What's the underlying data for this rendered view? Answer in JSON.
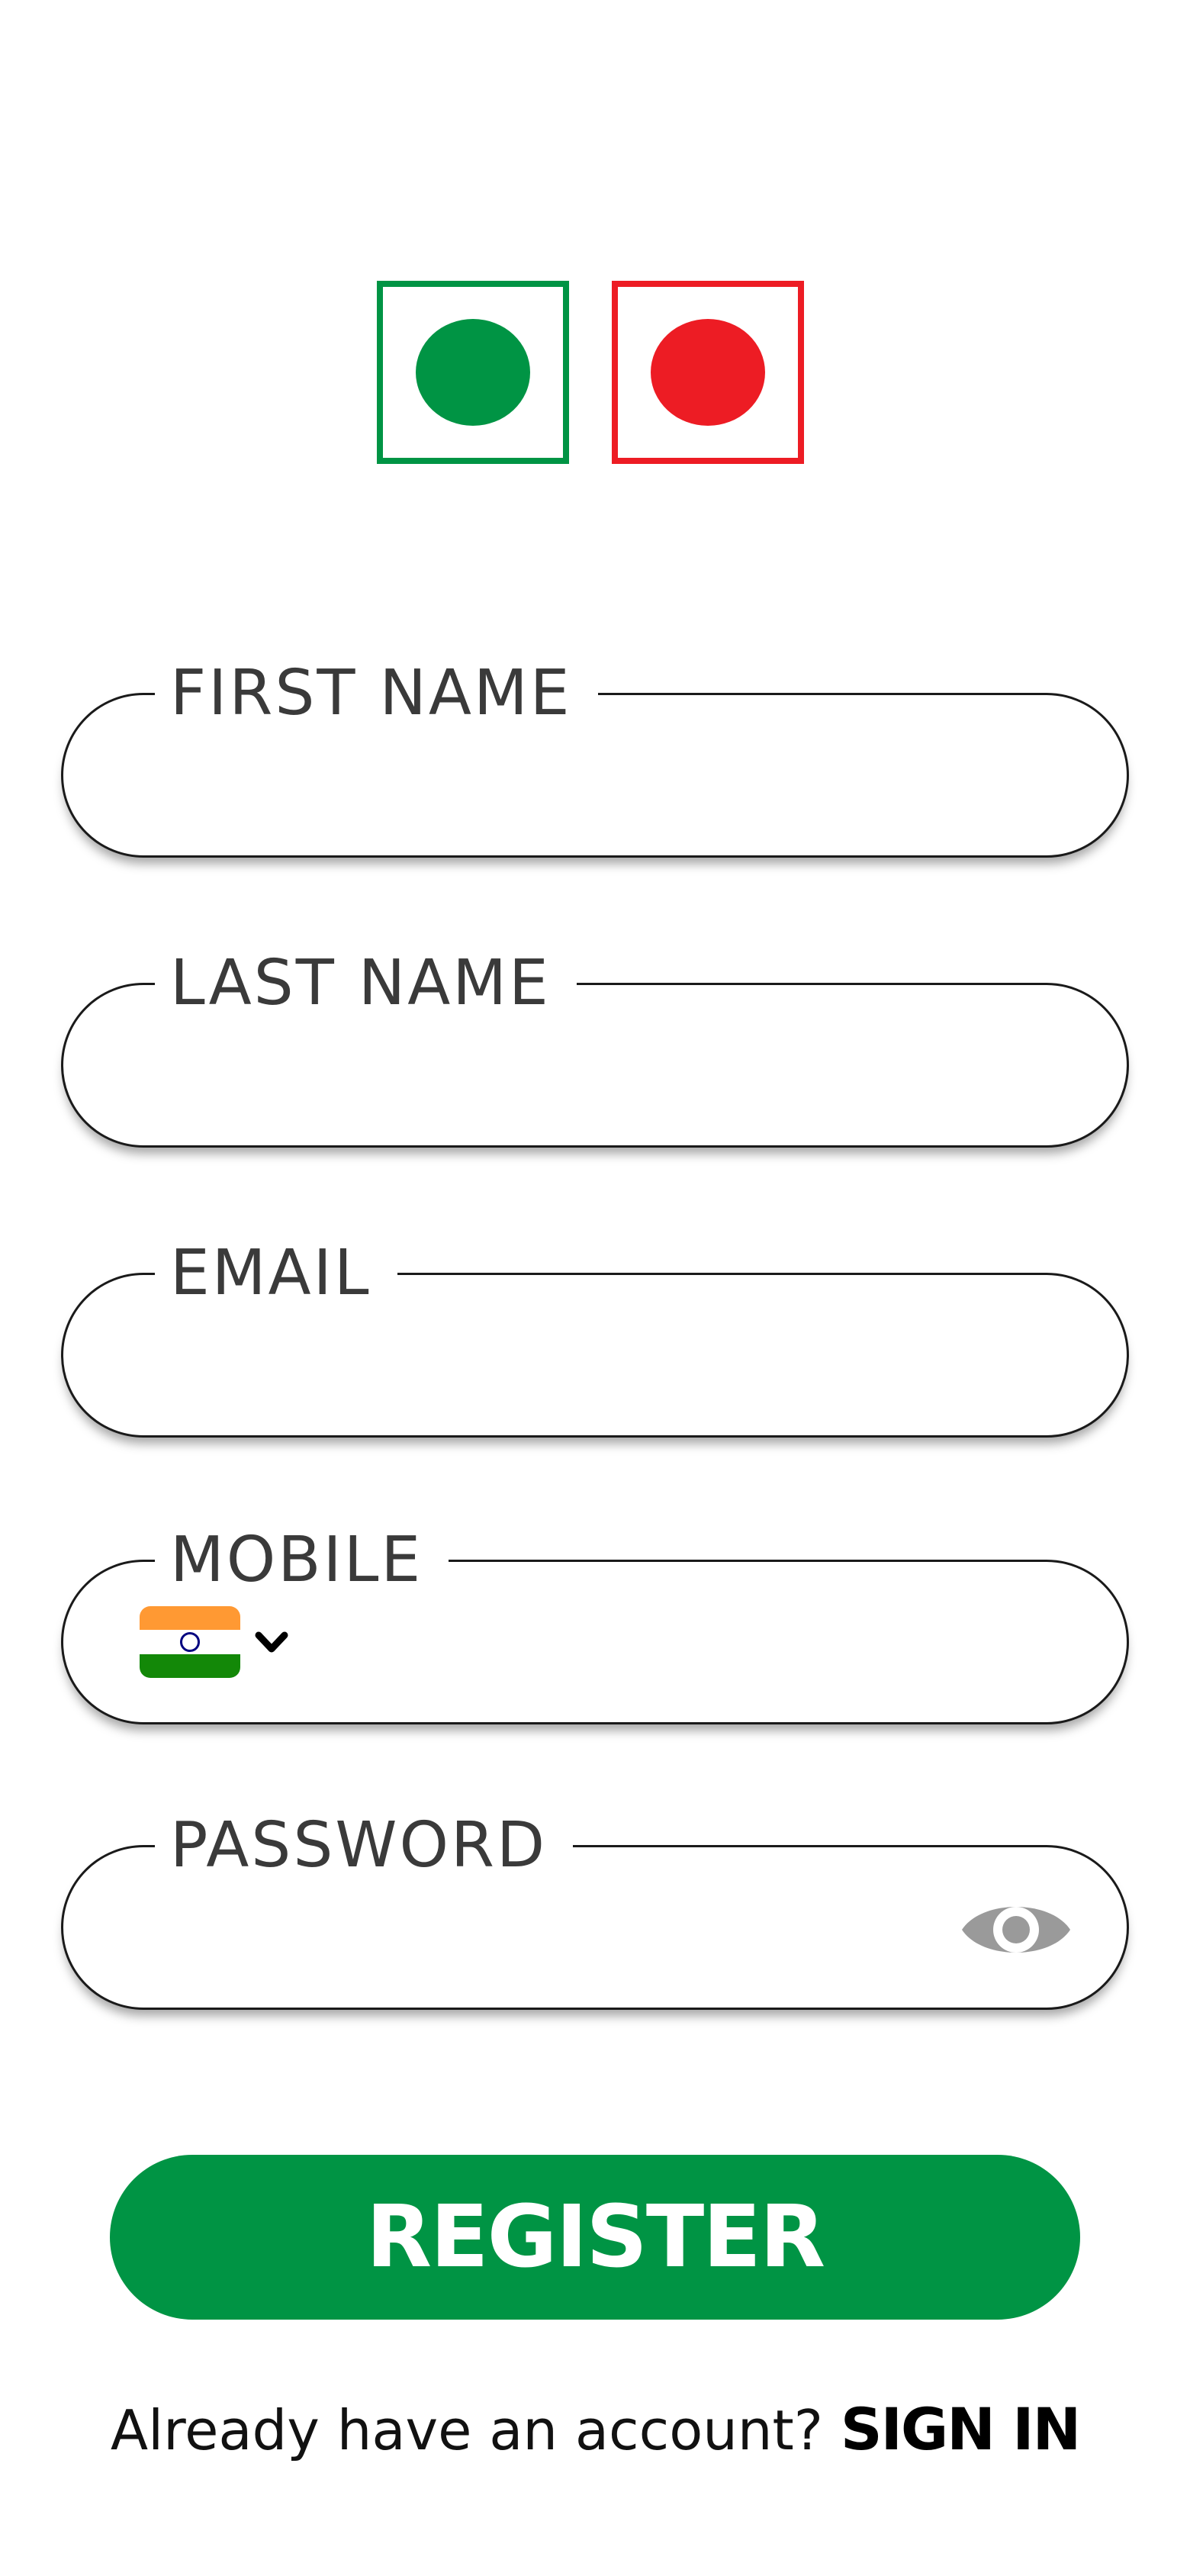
{
  "logo": {
    "left_color": "#009444",
    "right_color": "#ed1c24"
  },
  "fields": {
    "first_name": {
      "label": "FIRST NAME",
      "value": ""
    },
    "last_name": {
      "label": "LAST NAME",
      "value": ""
    },
    "email": {
      "label": "EMAIL",
      "value": ""
    },
    "mobile": {
      "label": "MOBILE",
      "value": "",
      "country_icon": "india-flag-icon",
      "dropdown_icon": "chevron-down-icon"
    },
    "password": {
      "label": "PASSWORD",
      "value": "",
      "toggle_icon": "eye-icon"
    }
  },
  "register_button": {
    "label": "REGISTER",
    "color": "#009444"
  },
  "footer": {
    "prompt": "Already have an account?",
    "link": "SIGN IN"
  }
}
